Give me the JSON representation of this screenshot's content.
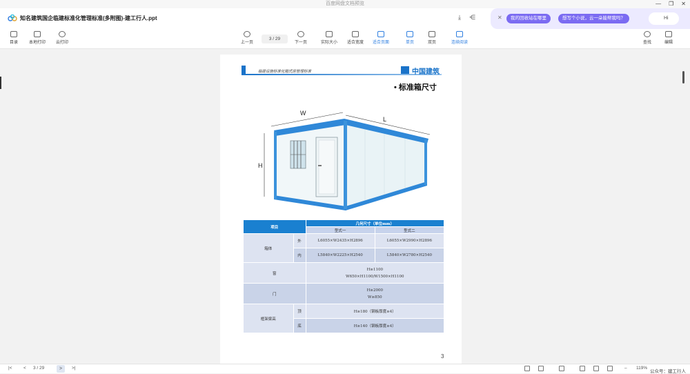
{
  "window": {
    "title": "百度网盘文档预览",
    "controls": [
      "—",
      "❐",
      "✕"
    ]
  },
  "file": {
    "name": "知名建筑国企临建标准化管理标准(多附图)-建工行人.ppt"
  },
  "ai_bar": {
    "chips": [
      "我的回收站在哪里",
      "想写个小说，云一朵能帮我吗？"
    ],
    "greeting": "Hi"
  },
  "toolbar": {
    "left": [
      "目录",
      "本地打印",
      "云打印"
    ],
    "prev": "上一页",
    "page_current": "3",
    "page_total": "/ 29",
    "next": "下一页",
    "view": [
      "实际大小",
      "适合宽度",
      "适合页面",
      "单页",
      "双页",
      "连续阅读"
    ],
    "right": [
      "查找",
      "编辑"
    ]
  },
  "page": {
    "header_text": "临建设施标准化箱式房管理标准",
    "brand": "中国建筑",
    "title": "•  标准箱尺寸",
    "dims": {
      "w": "W",
      "l": "L",
      "h": "H"
    },
    "number": "3",
    "table": {
      "col_item": "项目",
      "col_dims": "几何尺寸（单位mm）",
      "type1": "型式一",
      "type2": "型式二",
      "box": "箱体",
      "outer": "外",
      "inner": "内",
      "outer_1": "L6055×W2435×H2896",
      "outer_2": "L6055×W2990×H2896",
      "inner_1": "L5840×W2225×H2540",
      "inner_2": "L5840×W2780×H2540",
      "window": "窗",
      "window_1": "H≥1100",
      "window_2": "W650×H1100/W1500×H1100",
      "door": "门",
      "door_1": "H≥2000",
      "door_2": "W≥850",
      "frame": "框架梁高",
      "top": "顶",
      "bottom": "底",
      "top_val": "H≥180（钢板厚度≥4）",
      "bottom_val": "H≥140（钢板厚度≥4）"
    }
  },
  "statusbar": {
    "page": "3 / 29",
    "zoom": "119%",
    "watermark": "公众号：建工行人"
  }
}
